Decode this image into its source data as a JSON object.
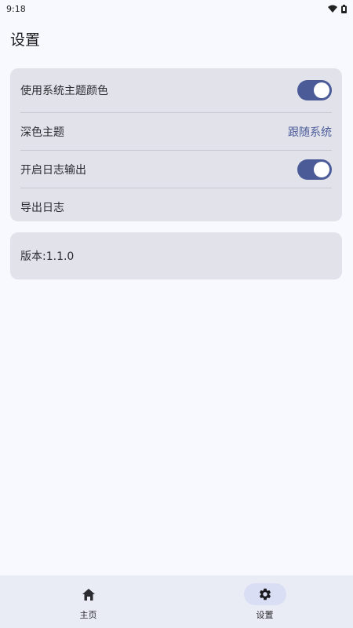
{
  "status_bar": {
    "time": "9:18",
    "icons": [
      "wifi-icon",
      "battery-icon"
    ]
  },
  "page": {
    "title": "设置"
  },
  "settings": {
    "items": [
      {
        "label": "使用系统主题颜色",
        "type": "toggle",
        "enabled": true
      },
      {
        "label": "深色主题",
        "type": "value",
        "value": "跟随系统"
      },
      {
        "label": "开启日志输出",
        "type": "toggle",
        "enabled": true
      },
      {
        "label": "导出日志",
        "type": "action"
      }
    ]
  },
  "version": {
    "label": "版本:1.1.0"
  },
  "bottom_nav": {
    "items": [
      {
        "label": "主页",
        "icon": "home-icon",
        "active": false
      },
      {
        "label": "设置",
        "icon": "gear-icon",
        "active": true
      }
    ]
  },
  "colors": {
    "accent": "#4a5b98",
    "card_background": "#e2e2eb",
    "page_background": "#f8f9fe"
  }
}
